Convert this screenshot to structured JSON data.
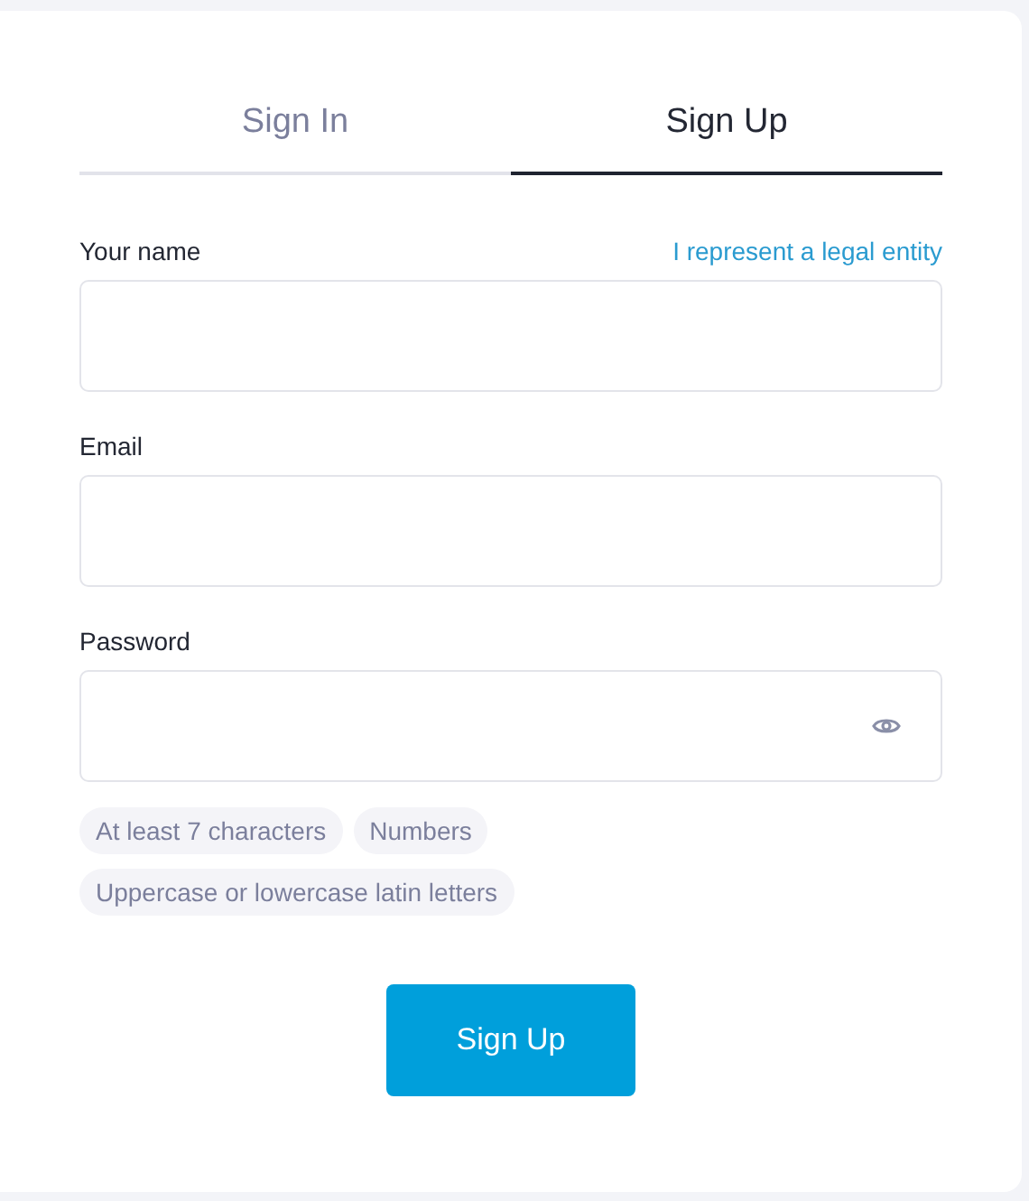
{
  "tabs": [
    {
      "label": "Sign In",
      "selected": false
    },
    {
      "label": "Sign Up",
      "selected": true
    }
  ],
  "fields": [
    {
      "label": "Your name",
      "link": "I represent a legal entity",
      "kind": "text"
    },
    {
      "label": "Email",
      "kind": "text"
    },
    {
      "label": "Password",
      "kind": "password"
    }
  ],
  "requirements": [
    "At least 7 characters",
    "Numbers",
    "Uppercase or lowercase latin letters"
  ],
  "submit_button": "Sign Up"
}
